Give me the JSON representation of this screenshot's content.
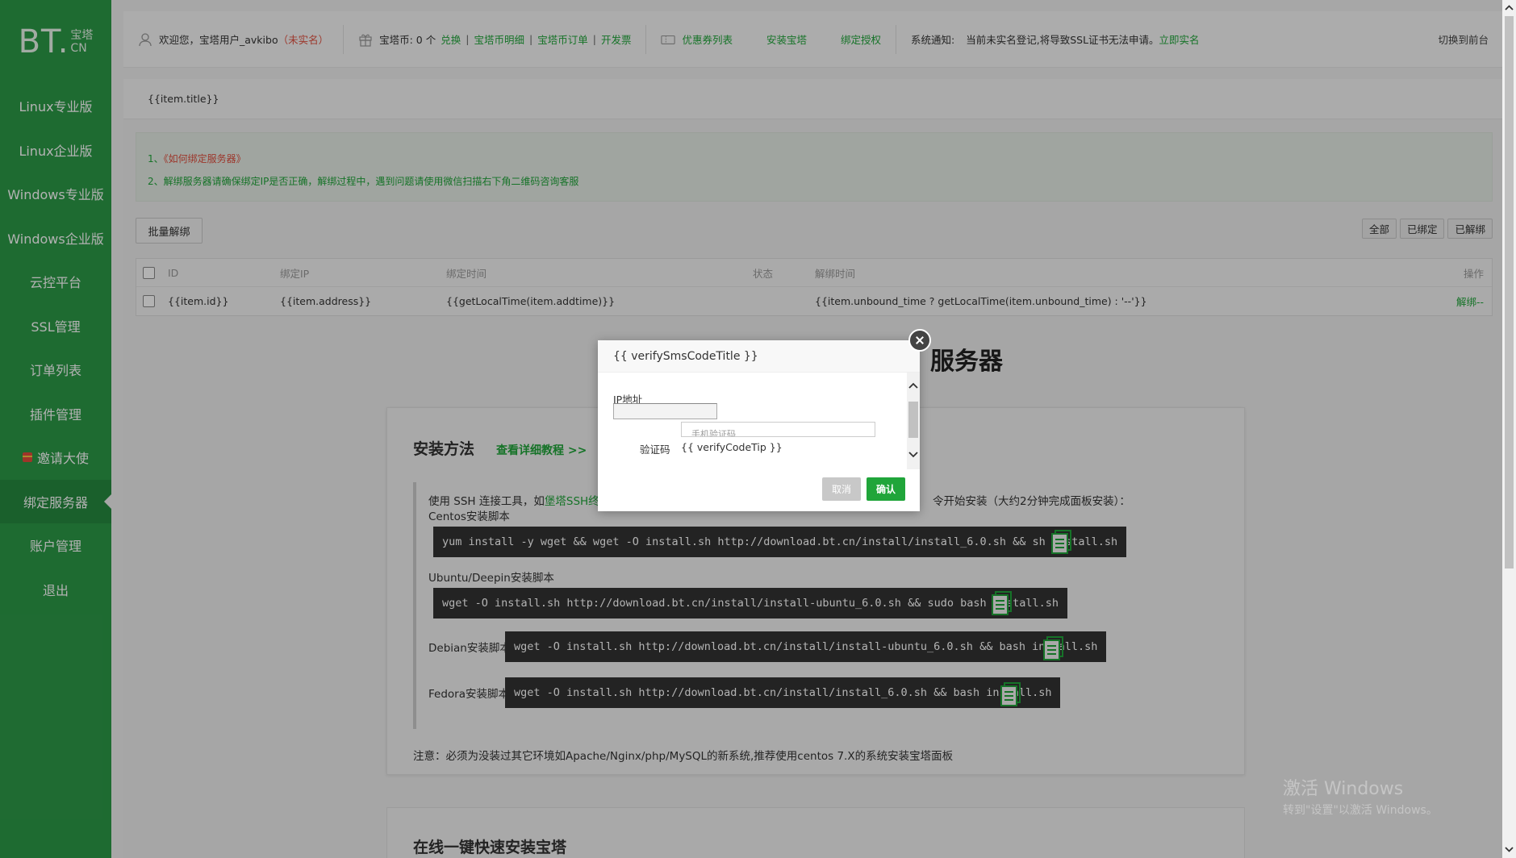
{
  "logo": {
    "main": "BT.",
    "cn_top": "宝塔",
    "cn_bottom": "CN"
  },
  "sidebar": {
    "items": [
      {
        "label": "Linux专业版"
      },
      {
        "label": "Linux企业版"
      },
      {
        "label": "Windows专业版"
      },
      {
        "label": "Windows企业版"
      },
      {
        "label": "云控平台"
      },
      {
        "label": "SSL管理"
      },
      {
        "label": "订单列表"
      },
      {
        "label": "插件管理"
      },
      {
        "label": "邀请大使"
      },
      {
        "label": "绑定服务器"
      },
      {
        "label": "账户管理"
      },
      {
        "label": "退出"
      }
    ],
    "active_index": 9
  },
  "topbar": {
    "welcome": "欢迎您，宝塔用户_avkibo",
    "unverified": "（未实名）",
    "coin_label": "宝塔币: 0 个",
    "exchange": "兑换",
    "coin_detail": "宝塔币明细",
    "coin_orders": "宝塔币订单",
    "invoice": "开发票",
    "coupons": "优惠券列表",
    "install": "安装宝塔",
    "bind_auth": "绑定授权",
    "notice_label": "系统通知:",
    "notice_text": "当前未实名登记,将导致SSL证书无法申请。",
    "notice_link": "立即实名",
    "switch_front": "切换到前台",
    "separator": "|"
  },
  "panel": {
    "title": "{{item.title}}",
    "tips": [
      {
        "num": "1、",
        "text": "《如何绑定服务器》"
      },
      {
        "num": "2、",
        "text": "解绑服务器请确保绑定IP是否正确，解绑过程中，遇到问题请使用微信扫描右下角二维码咨询客服"
      }
    ],
    "batch_unbind": "批量解绑",
    "filters": [
      "全部",
      "已绑定",
      "已解绑"
    ],
    "table": {
      "headers": {
        "id": "ID",
        "ip": "绑定IP",
        "time": "绑定时间",
        "status": "状态",
        "unbind_time": "解绑时间",
        "action": "操作"
      },
      "row": {
        "id": "{{item.id}}",
        "ip": "{{item.address}}",
        "time": "{{getLocalTime(item.addtime)}}",
        "unbind_time": "{{item.unbound_time ? getLocalTime(item.unbound_time) : '--'}}",
        "action": "解绑--"
      }
    }
  },
  "background": {
    "big_title": "服务器",
    "install_title": "安装方法",
    "install_more": "查看详细教程 >>",
    "intro_prefix": "使用 SSH 连接工具，如",
    "intro_link": "堡塔SSH终",
    "intro_suffix": "令开始安装（大约2分钟完成面板安装）：",
    "centos_label": "Centos安装脚本",
    "centos_cmd": "yum install -y wget && wget -O install.sh http://download.bt.cn/install/install_6.0.sh && sh install.sh",
    "ubuntu_label": "Ubuntu/Deepin安装脚本",
    "ubuntu_cmd": "wget -O install.sh http://download.bt.cn/install/install-ubuntu_6.0.sh && sudo bash install.sh",
    "debian_label": "Debian安装脚本",
    "debian_cmd": "wget -O install.sh http://download.bt.cn/install/install-ubuntu_6.0.sh && bash install.sh",
    "fedora_label": "Fedora安装脚本",
    "fedora_cmd": "wget -O install.sh http://download.bt.cn/install/install_6.0.sh && bash install.sh",
    "note": "注意：必须为没装过其它环境如Apache/Nginx/php/MySQL的新系统,推荐使用centos 7.X的系统安装宝塔面板",
    "online_title": "在线一键快速安装宝塔"
  },
  "modal": {
    "title": "{{ verifySmsCodeTitle }}",
    "ip_label": "IP地址",
    "sms_placeholder": "手机验证码",
    "code_label": "验证码",
    "code_tip": "{{ verifyCodeTip }}",
    "cancel": "取消",
    "confirm": "确认"
  },
  "watermark": {
    "line1": "激活 Windows",
    "line2": "转到\"设置\"以激活 Windows。"
  },
  "colors": {
    "brand_green": "#20a53a",
    "sidebar_bg": "#2c9a47",
    "alert_red": "#e0503f"
  }
}
